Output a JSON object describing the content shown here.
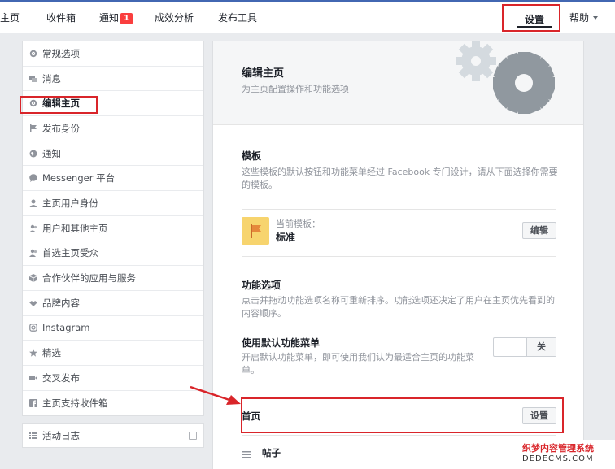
{
  "topnav": {
    "items": [
      "主页",
      "收件箱",
      "通知",
      "成效分析",
      "发布工具"
    ],
    "notification_count": "1",
    "settings_label": "设置",
    "help_label": "帮助"
  },
  "sidebar": {
    "items": [
      {
        "label": "常规选项",
        "icon": "gear-icon"
      },
      {
        "label": "消息",
        "icon": "chat-icon"
      },
      {
        "label": "编辑主页",
        "icon": "gear-icon"
      },
      {
        "label": "发布身份",
        "icon": "flag-icon"
      },
      {
        "label": "通知",
        "icon": "globe-icon"
      },
      {
        "label": "Messenger 平台",
        "icon": "messenger-icon"
      },
      {
        "label": "主页用户身份",
        "icon": "person-icon"
      },
      {
        "label": "用户和其他主页",
        "icon": "people-icon"
      },
      {
        "label": "首选主页受众",
        "icon": "people-icon"
      },
      {
        "label": "合作伙伴的应用与服务",
        "icon": "cube-icon"
      },
      {
        "label": "品牌内容",
        "icon": "handshake-icon"
      },
      {
        "label": "Instagram",
        "icon": "instagram-icon"
      },
      {
        "label": "精选",
        "icon": "star-icon"
      },
      {
        "label": "交叉发布",
        "icon": "video-icon"
      },
      {
        "label": "主页支持收件箱",
        "icon": "facebook-icon"
      }
    ],
    "activity_log": "活动日志"
  },
  "main": {
    "title": "编辑主页",
    "subtitle": "为主页配置操作和功能选项",
    "templates": {
      "title": "模板",
      "description": "这些模板的默认按钮和功能菜单经过 Facebook 专门设计，请从下面选择你需要的模板。",
      "current_label": "当前模板：",
      "current_value": "标准",
      "edit_button": "编辑"
    },
    "features": {
      "title": "功能选项",
      "description": "点击并拖动功能选项名称可重新排序。功能选项还决定了用户在主页优先看到的内容顺序。",
      "default_menu_label": "使用默认功能菜单",
      "default_menu_description": "开启默认功能菜单，即可使用我们认为最适合主页的功能菜单。",
      "toggle_state": "关"
    },
    "tabs": [
      {
        "label": "首页",
        "button": "设置"
      },
      {
        "label": "帖子"
      }
    ]
  },
  "watermark": {
    "line1": "织梦内容管理系统",
    "line2": "DEDECMS.COM"
  },
  "colors": {
    "accent": "#4267b2",
    "highlight": "#d9252a",
    "badge": "#fa3e3e"
  }
}
